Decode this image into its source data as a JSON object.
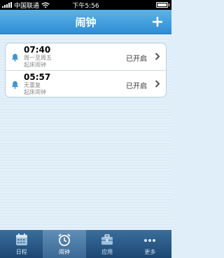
{
  "status_bar": {
    "carrier": "中国联通",
    "time": "下午5:56"
  },
  "header": {
    "title": "闹钟",
    "add_label": "+"
  },
  "alarms": [
    {
      "time": "07:40",
      "repeat": "周一至周五",
      "label": "起床闹钟",
      "status": "已开启"
    },
    {
      "time": "05:57",
      "repeat": "无重复",
      "label": "起床闹钟",
      "status": "已开启"
    }
  ],
  "tabs": [
    {
      "label": "日程",
      "icon": "calendar-icon",
      "active": false
    },
    {
      "label": "闹钟",
      "icon": "alarm-clock-icon",
      "active": true
    },
    {
      "label": "应用",
      "icon": "toolbox-icon",
      "active": false
    },
    {
      "label": "更多",
      "icon": "more-dots-icon",
      "active": false
    }
  ],
  "colors": {
    "accent": "#2f8dd3",
    "tab_bar": "#1c4773"
  }
}
